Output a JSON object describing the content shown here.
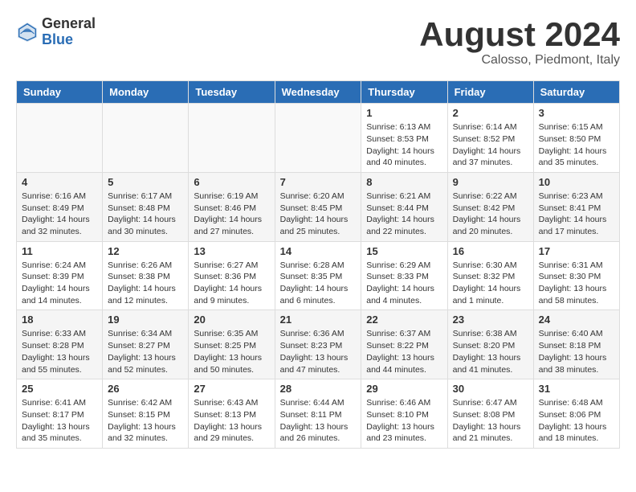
{
  "header": {
    "logo_general": "General",
    "logo_blue": "Blue",
    "month_title": "August 2024",
    "location": "Calosso, Piedmont, Italy"
  },
  "weekdays": [
    "Sunday",
    "Monday",
    "Tuesday",
    "Wednesday",
    "Thursday",
    "Friday",
    "Saturday"
  ],
  "weeks": [
    [
      {
        "day": "",
        "sunrise": "",
        "sunset": "",
        "daylight": ""
      },
      {
        "day": "",
        "sunrise": "",
        "sunset": "",
        "daylight": ""
      },
      {
        "day": "",
        "sunrise": "",
        "sunset": "",
        "daylight": ""
      },
      {
        "day": "",
        "sunrise": "",
        "sunset": "",
        "daylight": ""
      },
      {
        "day": "1",
        "sunrise": "Sunrise: 6:13 AM",
        "sunset": "Sunset: 8:53 PM",
        "daylight": "Daylight: 14 hours and 40 minutes."
      },
      {
        "day": "2",
        "sunrise": "Sunrise: 6:14 AM",
        "sunset": "Sunset: 8:52 PM",
        "daylight": "Daylight: 14 hours and 37 minutes."
      },
      {
        "day": "3",
        "sunrise": "Sunrise: 6:15 AM",
        "sunset": "Sunset: 8:50 PM",
        "daylight": "Daylight: 14 hours and 35 minutes."
      }
    ],
    [
      {
        "day": "4",
        "sunrise": "Sunrise: 6:16 AM",
        "sunset": "Sunset: 8:49 PM",
        "daylight": "Daylight: 14 hours and 32 minutes."
      },
      {
        "day": "5",
        "sunrise": "Sunrise: 6:17 AM",
        "sunset": "Sunset: 8:48 PM",
        "daylight": "Daylight: 14 hours and 30 minutes."
      },
      {
        "day": "6",
        "sunrise": "Sunrise: 6:19 AM",
        "sunset": "Sunset: 8:46 PM",
        "daylight": "Daylight: 14 hours and 27 minutes."
      },
      {
        "day": "7",
        "sunrise": "Sunrise: 6:20 AM",
        "sunset": "Sunset: 8:45 PM",
        "daylight": "Daylight: 14 hours and 25 minutes."
      },
      {
        "day": "8",
        "sunrise": "Sunrise: 6:21 AM",
        "sunset": "Sunset: 8:44 PM",
        "daylight": "Daylight: 14 hours and 22 minutes."
      },
      {
        "day": "9",
        "sunrise": "Sunrise: 6:22 AM",
        "sunset": "Sunset: 8:42 PM",
        "daylight": "Daylight: 14 hours and 20 minutes."
      },
      {
        "day": "10",
        "sunrise": "Sunrise: 6:23 AM",
        "sunset": "Sunset: 8:41 PM",
        "daylight": "Daylight: 14 hours and 17 minutes."
      }
    ],
    [
      {
        "day": "11",
        "sunrise": "Sunrise: 6:24 AM",
        "sunset": "Sunset: 8:39 PM",
        "daylight": "Daylight: 14 hours and 14 minutes."
      },
      {
        "day": "12",
        "sunrise": "Sunrise: 6:26 AM",
        "sunset": "Sunset: 8:38 PM",
        "daylight": "Daylight: 14 hours and 12 minutes."
      },
      {
        "day": "13",
        "sunrise": "Sunrise: 6:27 AM",
        "sunset": "Sunset: 8:36 PM",
        "daylight": "Daylight: 14 hours and 9 minutes."
      },
      {
        "day": "14",
        "sunrise": "Sunrise: 6:28 AM",
        "sunset": "Sunset: 8:35 PM",
        "daylight": "Daylight: 14 hours and 6 minutes."
      },
      {
        "day": "15",
        "sunrise": "Sunrise: 6:29 AM",
        "sunset": "Sunset: 8:33 PM",
        "daylight": "Daylight: 14 hours and 4 minutes."
      },
      {
        "day": "16",
        "sunrise": "Sunrise: 6:30 AM",
        "sunset": "Sunset: 8:32 PM",
        "daylight": "Daylight: 14 hours and 1 minute."
      },
      {
        "day": "17",
        "sunrise": "Sunrise: 6:31 AM",
        "sunset": "Sunset: 8:30 PM",
        "daylight": "Daylight: 13 hours and 58 minutes."
      }
    ],
    [
      {
        "day": "18",
        "sunrise": "Sunrise: 6:33 AM",
        "sunset": "Sunset: 8:28 PM",
        "daylight": "Daylight: 13 hours and 55 minutes."
      },
      {
        "day": "19",
        "sunrise": "Sunrise: 6:34 AM",
        "sunset": "Sunset: 8:27 PM",
        "daylight": "Daylight: 13 hours and 52 minutes."
      },
      {
        "day": "20",
        "sunrise": "Sunrise: 6:35 AM",
        "sunset": "Sunset: 8:25 PM",
        "daylight": "Daylight: 13 hours and 50 minutes."
      },
      {
        "day": "21",
        "sunrise": "Sunrise: 6:36 AM",
        "sunset": "Sunset: 8:23 PM",
        "daylight": "Daylight: 13 hours and 47 minutes."
      },
      {
        "day": "22",
        "sunrise": "Sunrise: 6:37 AM",
        "sunset": "Sunset: 8:22 PM",
        "daylight": "Daylight: 13 hours and 44 minutes."
      },
      {
        "day": "23",
        "sunrise": "Sunrise: 6:38 AM",
        "sunset": "Sunset: 8:20 PM",
        "daylight": "Daylight: 13 hours and 41 minutes."
      },
      {
        "day": "24",
        "sunrise": "Sunrise: 6:40 AM",
        "sunset": "Sunset: 8:18 PM",
        "daylight": "Daylight: 13 hours and 38 minutes."
      }
    ],
    [
      {
        "day": "25",
        "sunrise": "Sunrise: 6:41 AM",
        "sunset": "Sunset: 8:17 PM",
        "daylight": "Daylight: 13 hours and 35 minutes."
      },
      {
        "day": "26",
        "sunrise": "Sunrise: 6:42 AM",
        "sunset": "Sunset: 8:15 PM",
        "daylight": "Daylight: 13 hours and 32 minutes."
      },
      {
        "day": "27",
        "sunrise": "Sunrise: 6:43 AM",
        "sunset": "Sunset: 8:13 PM",
        "daylight": "Daylight: 13 hours and 29 minutes."
      },
      {
        "day": "28",
        "sunrise": "Sunrise: 6:44 AM",
        "sunset": "Sunset: 8:11 PM",
        "daylight": "Daylight: 13 hours and 26 minutes."
      },
      {
        "day": "29",
        "sunrise": "Sunrise: 6:46 AM",
        "sunset": "Sunset: 8:10 PM",
        "daylight": "Daylight: 13 hours and 23 minutes."
      },
      {
        "day": "30",
        "sunrise": "Sunrise: 6:47 AM",
        "sunset": "Sunset: 8:08 PM",
        "daylight": "Daylight: 13 hours and 21 minutes."
      },
      {
        "day": "31",
        "sunrise": "Sunrise: 6:48 AM",
        "sunset": "Sunset: 8:06 PM",
        "daylight": "Daylight: 13 hours and 18 minutes."
      }
    ]
  ]
}
